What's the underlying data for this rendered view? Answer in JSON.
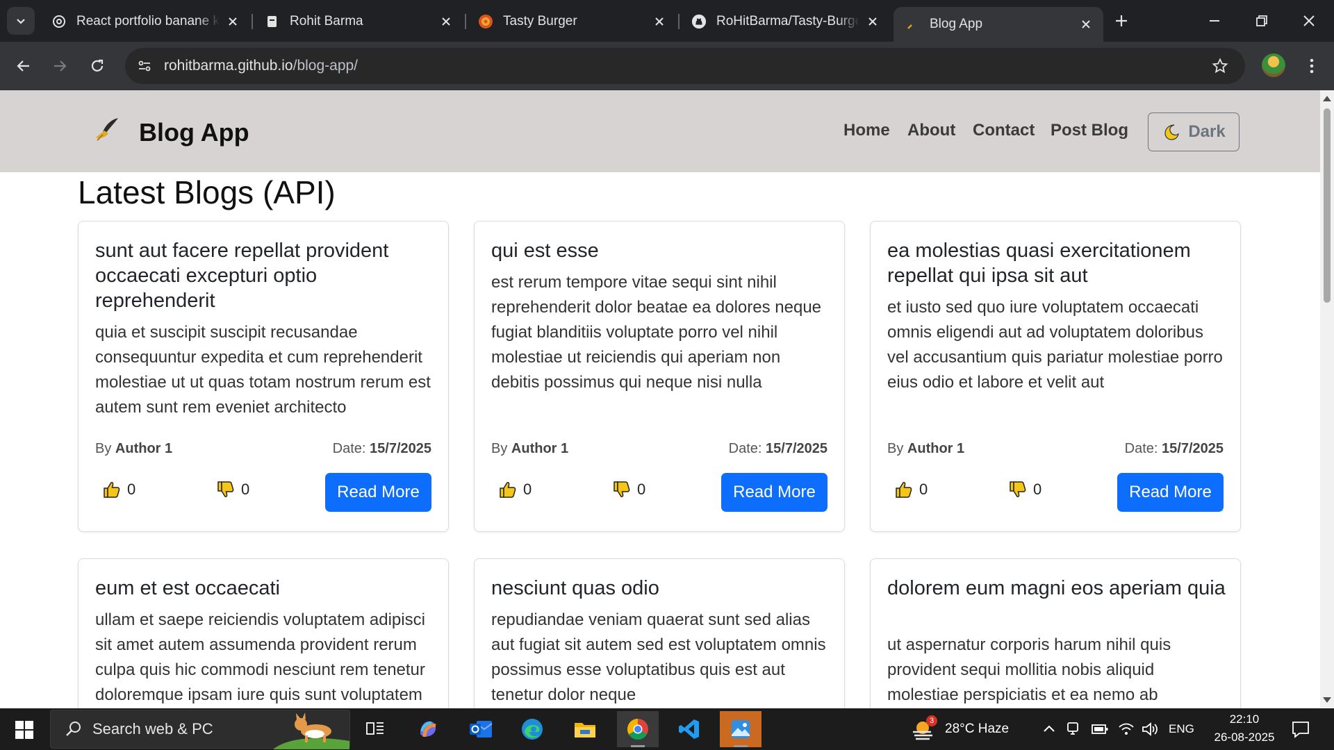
{
  "browser": {
    "tabs": [
      {
        "title": "React portfolio banane ki",
        "favicon": "openai-icon"
      },
      {
        "title": "Rohit Barma",
        "favicon": "document-icon"
      },
      {
        "title": "Tasty Burger",
        "favicon": "burger-icon"
      },
      {
        "title": "RoHitBarma/Tasty-Burger",
        "favicon": "github-icon"
      },
      {
        "title": "Blog App",
        "favicon": "quill-icon",
        "active": true
      }
    ],
    "url_host": "rohitbarma.github.io",
    "url_path": "/blog-app/"
  },
  "app": {
    "brand": "Blog App",
    "nav": [
      "Home",
      "About",
      "Contact",
      "Post Blog"
    ],
    "theme_button": "Dark",
    "page_title": "Latest Blogs (API)",
    "labels": {
      "by": "By",
      "date": "Date:",
      "read_more": "Read More"
    },
    "posts": [
      {
        "title": "sunt aut facere repellat provident occaecati excepturi optio reprehenderit",
        "body": "quia et suscipit suscipit recusandae consequuntur expedita et cum reprehenderit molestiae ut ut quas totam nostrum rerum est autem sunt rem eveniet architecto",
        "author": "Author 1",
        "date": "15/7/2025",
        "likes": "0",
        "dislikes": "0"
      },
      {
        "title": "qui est esse",
        "body": "est rerum tempore vitae sequi sint nihil reprehenderit dolor beatae ea dolores neque fugiat blanditiis voluptate porro vel nihil molestiae ut reiciendis qui aperiam non debitis possimus qui neque nisi nulla",
        "author": "Author 1",
        "date": "15/7/2025",
        "likes": "0",
        "dislikes": "0"
      },
      {
        "title": "ea molestias quasi exercitationem repellat qui ipsa sit aut",
        "body": "et iusto sed quo iure voluptatem occaecati omnis eligendi aut ad voluptatem doloribus vel accusantium quis pariatur molestiae porro eius odio et labore et velit aut",
        "author": "Author 1",
        "date": "15/7/2025",
        "likes": "0",
        "dislikes": "0"
      },
      {
        "title": "eum et est occaecati",
        "body": "ullam et saepe reiciendis voluptatem adipisci sit amet autem assumenda provident rerum culpa quis hic commodi nesciunt rem tenetur doloremque ipsam iure quis sunt voluptatem"
      },
      {
        "title": "nesciunt quas odio",
        "body": "repudiandae veniam quaerat sunt sed alias aut fugiat sit autem sed est voluptatem omnis possimus esse voluptatibus quis est aut tenetur dolor neque"
      },
      {
        "title": "dolorem eum magni eos aperiam quia",
        "body": "ut aspernatur corporis harum nihil quis provident sequi mollitia nobis aliquid molestiae perspiciatis et ea nemo ab"
      }
    ]
  },
  "taskbar": {
    "search_placeholder": "Search web & PC",
    "weather_badge": "3",
    "weather": "28°C  Haze",
    "language": "ENG",
    "time": "22:10",
    "date": "26-08-2025"
  },
  "colors": {
    "primary_button": "#0d6efd",
    "navbar_bg": "#d8d3d3",
    "chrome_dark": "#202124",
    "chrome_toolbar": "#35363a"
  }
}
